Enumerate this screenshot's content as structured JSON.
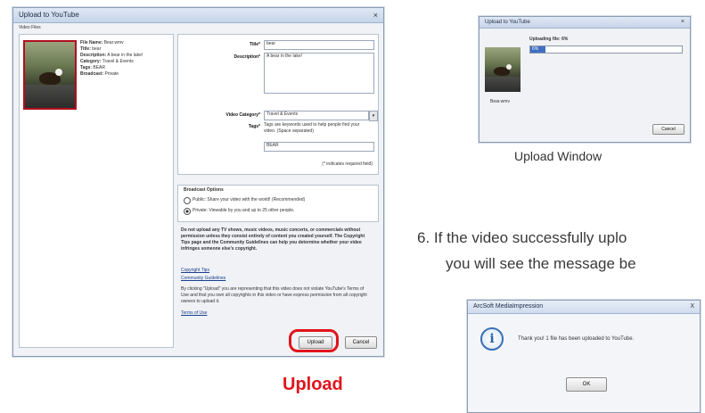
{
  "upload_dialog": {
    "title": "Upload to YouTube",
    "close": "×",
    "section_label": "Video Files",
    "file_info": {
      "file_name_label": "File Name:",
      "file_name_value": "Bear.wmv",
      "title_label": "Title:",
      "title_value": "bear",
      "description_label": "Description:",
      "description_value": "A bear in the lake!",
      "category_label": "Category:",
      "category_value": "Travel & Events",
      "tags_label": "Tags:",
      "tags_value": "BEAR",
      "broadcast_label": "Broadcast:",
      "broadcast_value": "Private"
    },
    "form": {
      "title_label": "Title*",
      "title_value": "bear",
      "description_label": "Description*",
      "description_value": "A bear in the lake!",
      "category_label": "Video Category*",
      "category_value": "Travel & Events",
      "tags_label": "Tags*",
      "tags_help": "Tags are keywords used to help people find your video. (Space separated)",
      "tags_value": "BEAR",
      "required_note": "(* indicates required field)"
    },
    "broadcast": {
      "heading": "Broadcast Options",
      "public_label": "Public: Share your video with the world! (Recommended)",
      "private_label": "Private: Viewable by you and up to 25 other people.",
      "selected": "private"
    },
    "terms": {
      "warning": "Do not upload any TV shows, music videos, music concerts, or commercials without permission unless they consist entirely of content you created yourself. The Copyright Tips page and the Community Guidelines can help you determine whether your video infringes someone else's copyright.",
      "copyright_tips_link": "Copyright Tips",
      "guidelines_link": "Community Guidelines",
      "agreement": "By clicking \"Upload\" you are representing that this video does not violate YouTube's Terms of Use and that you own all copyrights in this video or have express permission from all copyright owners to upload it.",
      "terms_link": "Terms of Use"
    },
    "upload_button": "Upload",
    "cancel_button": "Cancel"
  },
  "upload_caption": "Upload",
  "upload_window": {
    "title": "Upload to YouTube",
    "close": "×",
    "status": "Uploading file: 6%",
    "progress_text": "6%",
    "progress": 0.06,
    "file_name": "Bear.wmv",
    "cancel_button": "Cancel"
  },
  "upload_window_caption": "Upload Window",
  "step_text_line1": "6. If the video successfully uplo",
  "step_text_line2": "you will see the message be",
  "message_box": {
    "title": "ArcSoft MediaImpression",
    "close": "X",
    "message": "Thank you! 1 file has been uploaded to YouTube.",
    "ok_button": "OK"
  },
  "colors": {
    "accent_red": "#e1141c"
  }
}
